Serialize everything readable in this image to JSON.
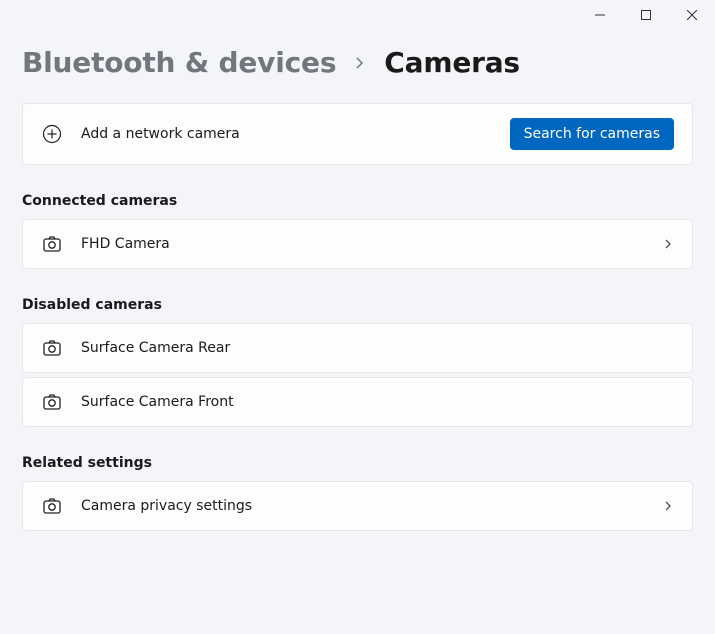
{
  "breadcrumb": {
    "parent": "Bluetooth & devices",
    "current": "Cameras"
  },
  "add_card": {
    "label": "Add a network camera",
    "button": "Search for cameras"
  },
  "sections": {
    "connected": {
      "title": "Connected cameras",
      "items": [
        {
          "label": "FHD Camera"
        }
      ]
    },
    "disabled": {
      "title": "Disabled cameras",
      "items": [
        {
          "label": "Surface Camera Rear"
        },
        {
          "label": "Surface Camera Front"
        }
      ]
    },
    "related": {
      "title": "Related settings",
      "items": [
        {
          "label": "Camera privacy settings"
        }
      ]
    }
  }
}
